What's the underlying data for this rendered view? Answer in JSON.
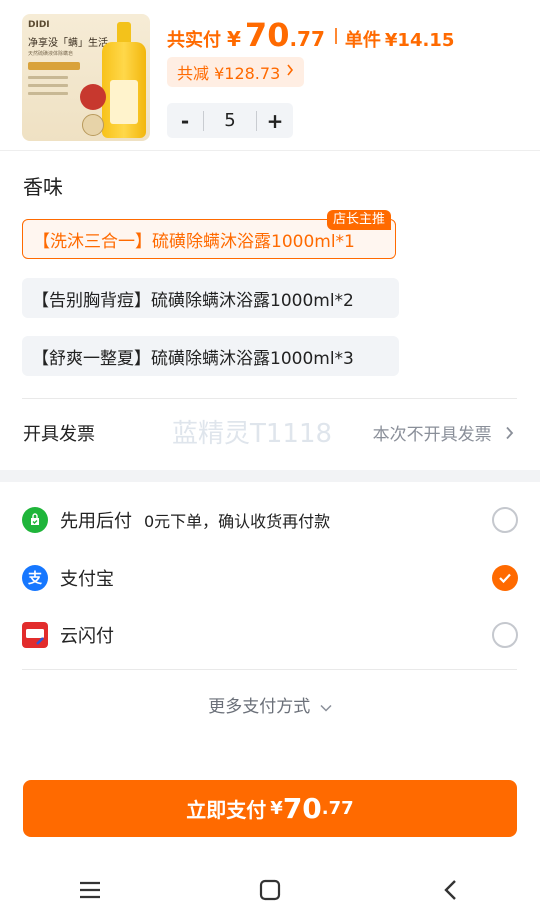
{
  "product": {
    "image_brand": "DIDI",
    "image_slogan": "净享没「螨」生活",
    "image_subtitle": "天然硫磺液体除螨皂",
    "price_label": "共实付",
    "price_currency": "¥",
    "price_int": "70",
    "price_dec": ".77",
    "unit_label": "单件",
    "unit_price": "¥14.15",
    "discount_text": "共减 ¥128.73",
    "discount_chevron": "chevron-right-icon",
    "quantity": "5",
    "minus_label": "-",
    "plus_label": "+"
  },
  "scent": {
    "title": "香味",
    "options": [
      {
        "label": "【洗沐三合一】硫磺除螨沐浴露1000ml*1",
        "selected": true
      },
      {
        "label": "【告别胸背痘】硫磺除螨沐浴露1000ml*2",
        "selected": false
      },
      {
        "label": "【舒爽一整夏】硫磺除螨沐浴露1000ml*3",
        "selected": false
      }
    ],
    "badge": "店长主推"
  },
  "invoice": {
    "label": "开具发票",
    "value": "本次不开具发票",
    "watermark": "蓝精灵T1118"
  },
  "payment": {
    "methods": [
      {
        "icon": "wechat-pay-icon",
        "name": "先用后付",
        "desc": "0元下单，确认收货再付款",
        "checked": false
      },
      {
        "icon": "alipay-icon",
        "name": "支付宝",
        "desc": "",
        "checked": false
      },
      {
        "icon": "unionpay-icon",
        "name": "云闪付",
        "desc": "",
        "checked": false
      }
    ],
    "selected_index": 1,
    "more_label": "更多支付方式"
  },
  "pay_button": {
    "label": "立即支付",
    "currency": "¥",
    "int": "70",
    "dec": ".77"
  },
  "colors": {
    "accent": "#ff6a00",
    "alipay": "#1677ff",
    "wechat": "#1fb53a"
  }
}
